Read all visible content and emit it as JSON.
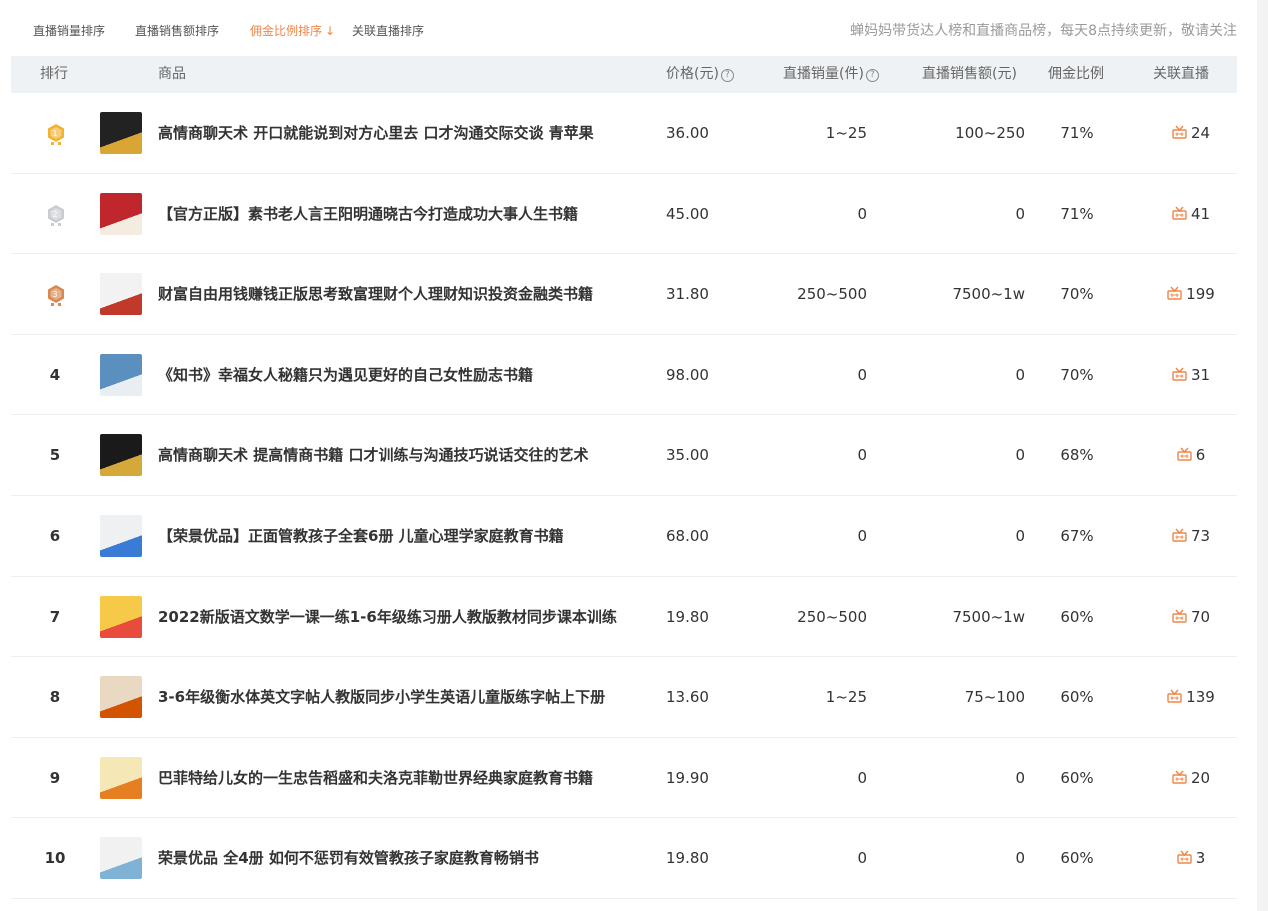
{
  "sort_tabs": [
    {
      "label": "直播销量排序",
      "active": false
    },
    {
      "label": "直播销售额排序",
      "active": false
    },
    {
      "label": "佣金比例排序",
      "active": true
    },
    {
      "label": "关联直播排序",
      "active": false
    }
  ],
  "notice": "蝉妈妈带货达人榜和直播商品榜，每天8点持续更新，敬请关注",
  "columns": {
    "rank": "排行",
    "product": "商品",
    "price": "价格(元)",
    "sales": "直播销量(件)",
    "revenue": "直播销售额(元)",
    "commission": "佣金比例",
    "live": "关联直播"
  },
  "colors": {
    "accent": "#f08549",
    "header_bg": "#eef2f5",
    "gold": "#f2b233",
    "silver": "#c9cdd2",
    "bronze": "#d9894f"
  },
  "rows": [
    {
      "rank": "1",
      "medal": "gold",
      "thumb": [
        "#222222",
        "#d9a635"
      ],
      "title": "高情商聊天术 开口就能说到对方心里去 口才沟通交际交谈 青苹果",
      "price": "36.00",
      "sales": "1~25",
      "revenue": "100~250",
      "commission": "71%",
      "live": "24"
    },
    {
      "rank": "2",
      "medal": "silver",
      "thumb": [
        "#c0272d",
        "#f4ece0"
      ],
      "title": "【官方正版】素书老人言王阳明通晓古今打造成功大事人生书籍",
      "price": "45.00",
      "sales": "0",
      "revenue": "0",
      "commission": "71%",
      "live": "41"
    },
    {
      "rank": "3",
      "medal": "bronze",
      "thumb": [
        "#f2f2f2",
        "#c0392b"
      ],
      "title": "财富自由用钱赚钱正版思考致富理财个人理财知识投资金融类书籍",
      "price": "31.80",
      "sales": "250~500",
      "revenue": "7500~1w",
      "commission": "70%",
      "live": "199"
    },
    {
      "rank": "4",
      "medal": "",
      "thumb": [
        "#5b8fbf",
        "#e9eef3"
      ],
      "title": "《知书》幸福女人秘籍只为遇见更好的自己女性励志书籍",
      "price": "98.00",
      "sales": "0",
      "revenue": "0",
      "commission": "70%",
      "live": "31"
    },
    {
      "rank": "5",
      "medal": "",
      "thumb": [
        "#1a1a1a",
        "#d4a93a"
      ],
      "title": "高情商聊天术 提高情商书籍 口才训练与沟通技巧说话交往的艺术",
      "price": "35.00",
      "sales": "0",
      "revenue": "0",
      "commission": "68%",
      "live": "6"
    },
    {
      "rank": "6",
      "medal": "",
      "thumb": [
        "#eef0f2",
        "#3a7bd5"
      ],
      "title": "【荣景优品】正面管教孩子全套6册 儿童心理学家庭教育书籍",
      "price": "68.00",
      "sales": "0",
      "revenue": "0",
      "commission": "67%",
      "live": "73"
    },
    {
      "rank": "7",
      "medal": "",
      "thumb": [
        "#f7c948",
        "#e74c3c"
      ],
      "title": "2022新版语文数学一课一练1-6年级练习册人教版教材同步课本训练",
      "price": "19.80",
      "sales": "250~500",
      "revenue": "7500~1w",
      "commission": "60%",
      "live": "70"
    },
    {
      "rank": "8",
      "medal": "",
      "thumb": [
        "#e9d9c3",
        "#d35400"
      ],
      "title": "3-6年级衡水体英文字帖人教版同步小学生英语儿童版练字帖上下册",
      "price": "13.60",
      "sales": "1~25",
      "revenue": "75~100",
      "commission": "60%",
      "live": "139"
    },
    {
      "rank": "9",
      "medal": "",
      "thumb": [
        "#f6e7b6",
        "#e67e22"
      ],
      "title": "巴菲特给儿女的一生忠告稻盛和夫洛克菲勒世界经典家庭教育书籍",
      "price": "19.90",
      "sales": "0",
      "revenue": "0",
      "commission": "60%",
      "live": "20"
    },
    {
      "rank": "10",
      "medal": "",
      "thumb": [
        "#f1f1f1",
        "#7fb3d5"
      ],
      "title": "荣景优品 全4册 如何不惩罚有效管教孩子家庭教育畅销书",
      "price": "19.80",
      "sales": "0",
      "revenue": "0",
      "commission": "60%",
      "live": "3"
    }
  ]
}
